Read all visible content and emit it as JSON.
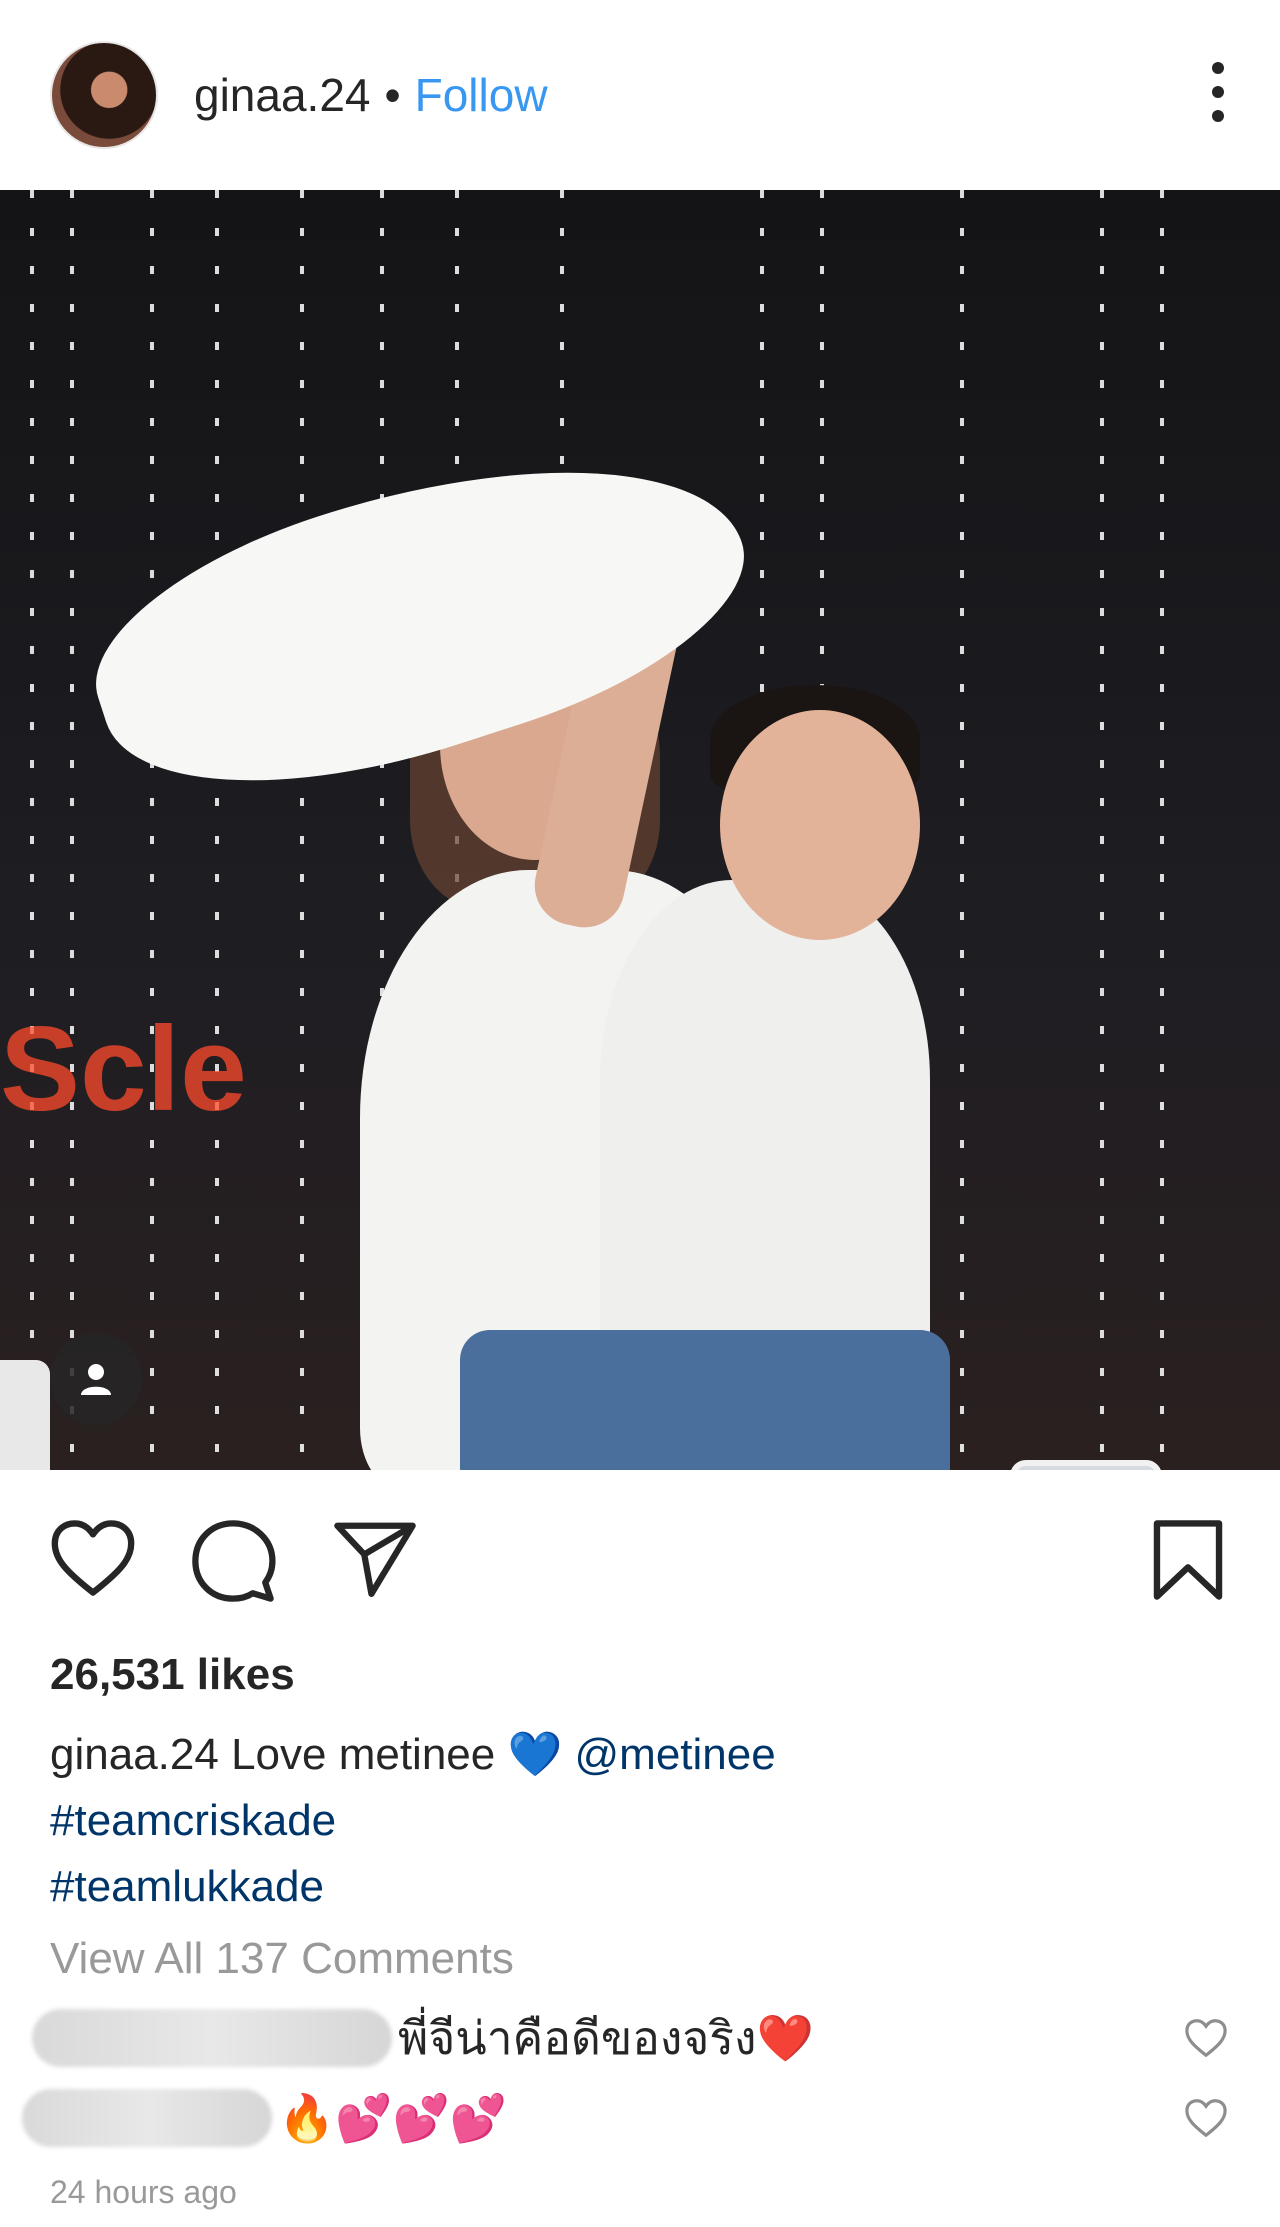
{
  "header": {
    "username": "ginaa.24",
    "separator": "•",
    "follow_label": "Follow",
    "more_icon": "more-vertical-icon"
  },
  "photo": {
    "sign_text": "Scle",
    "tag_icon": "user-icon"
  },
  "actions": {
    "like_icon": "heart-icon",
    "comment_icon": "comment-icon",
    "share_icon": "share-icon",
    "save_icon": "bookmark-icon"
  },
  "post": {
    "likes": "26,531 likes",
    "caption_user": "ginaa.24",
    "caption_text": "Love metinee",
    "caption_emoji": "💙",
    "mention": "@metinee",
    "hashtags": [
      "#teamcriskade",
      "#teamlukkade"
    ],
    "view_all": "View All 137 Comments",
    "time": "24 hours ago"
  },
  "comments": [
    {
      "text": "พี่จีน่าคือดีของจริง❤️"
    },
    {
      "text": "🔥💕💕💕"
    }
  ],
  "colors": {
    "link": "#003569",
    "follow": "#3897f0",
    "muted": "#999999"
  }
}
